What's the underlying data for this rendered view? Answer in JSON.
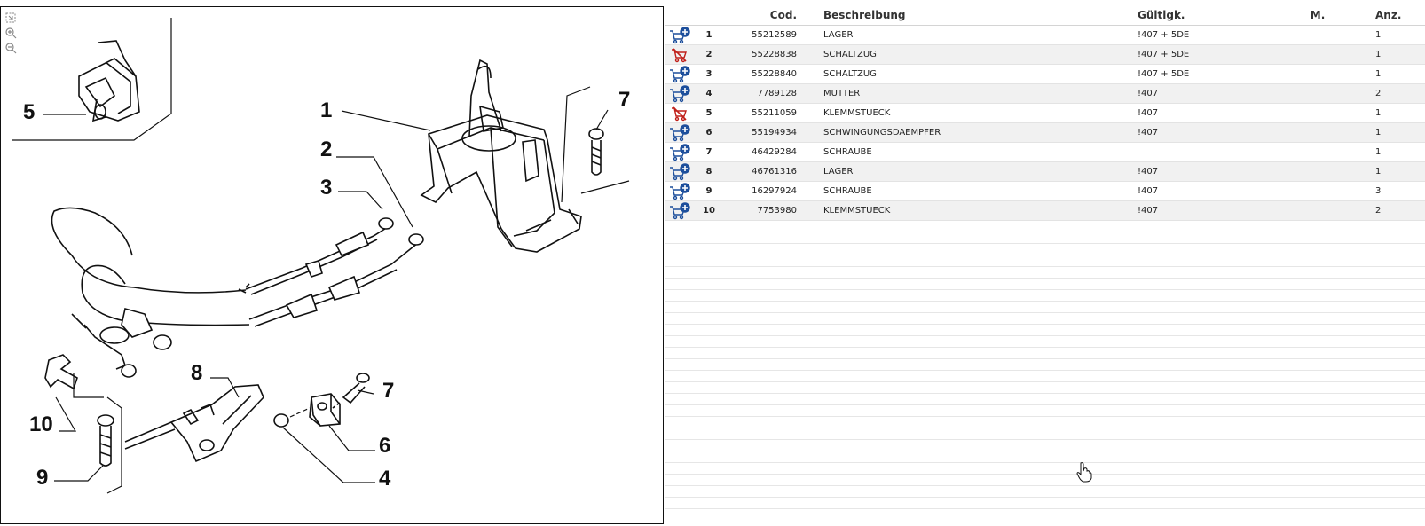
{
  "drawing": {
    "callouts": [
      "5",
      "1",
      "2",
      "3",
      "7",
      "8",
      "7",
      "10",
      "6",
      "9",
      "4"
    ]
  },
  "zoom_tools": [
    "fit-page-icon",
    "zoom-in-icon",
    "zoom-out-icon"
  ],
  "table": {
    "headers": {
      "code": "Cod.",
      "description": "Beschreibung",
      "validity": "Gültigk.",
      "m": "M.",
      "qty": "Anz."
    },
    "rows": [
      {
        "icon": "cart-add-icon",
        "pos": "1",
        "code": "55212589",
        "description": "LAGER",
        "validity": "!407 + 5DE",
        "m": "",
        "qty": "1"
      },
      {
        "icon": "cart-unavailable-icon",
        "pos": "2",
        "code": "55228838",
        "description": "SCHALTZUG",
        "validity": "!407 + 5DE",
        "m": "",
        "qty": "1"
      },
      {
        "icon": "cart-add-icon",
        "pos": "3",
        "code": "55228840",
        "description": "SCHALTZUG",
        "validity": "!407 + 5DE",
        "m": "",
        "qty": "1"
      },
      {
        "icon": "cart-add-icon",
        "pos": "4",
        "code": "7789128",
        "description": "MUTTER",
        "validity": "!407",
        "m": "",
        "qty": "2"
      },
      {
        "icon": "cart-unavailable-icon",
        "pos": "5",
        "code": "55211059",
        "description": "KLEMMSTUECK",
        "validity": "!407",
        "m": "",
        "qty": "1"
      },
      {
        "icon": "cart-add-icon",
        "pos": "6",
        "code": "55194934",
        "description": "SCHWINGUNGSDAEMPFER",
        "validity": "!407",
        "m": "",
        "qty": "1"
      },
      {
        "icon": "cart-add-icon",
        "pos": "7",
        "code": "46429284",
        "description": "SCHRAUBE",
        "validity": "",
        "m": "",
        "qty": "1"
      },
      {
        "icon": "cart-add-icon",
        "pos": "8",
        "code": "46761316",
        "description": "LAGER",
        "validity": "!407",
        "m": "",
        "qty": "1"
      },
      {
        "icon": "cart-add-icon",
        "pos": "9",
        "code": "16297924",
        "description": "SCHRAUBE",
        "validity": "!407",
        "m": "",
        "qty": "3"
      },
      {
        "icon": "cart-add-icon",
        "pos": "10",
        "code": "7753980",
        "description": "KLEMMSTUECK",
        "validity": "!407",
        "m": "",
        "qty": "2"
      }
    ]
  },
  "colors": {
    "cart_blue": "#1d4f9c",
    "cart_red": "#c0201a",
    "row_alt": "#f1f1f1"
  }
}
